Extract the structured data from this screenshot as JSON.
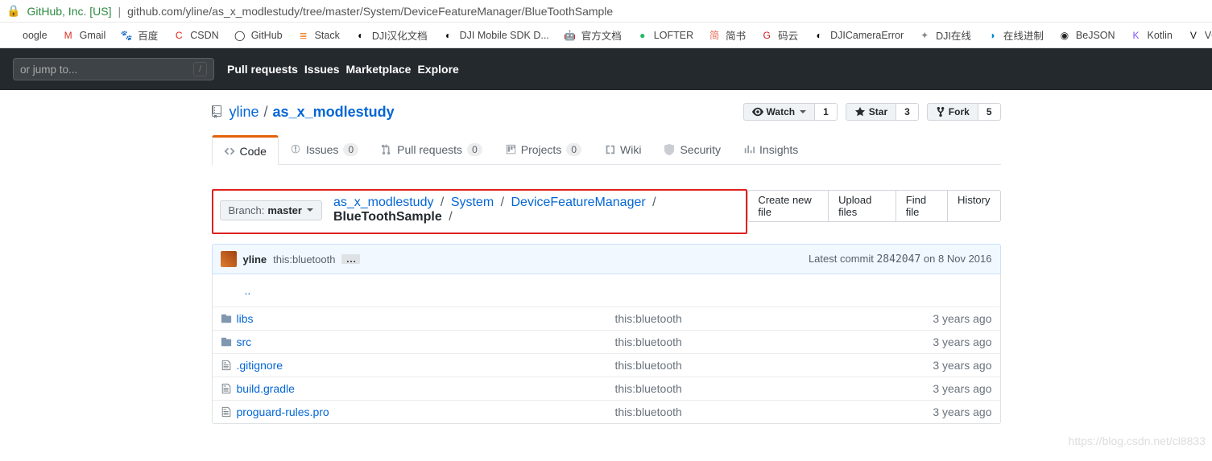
{
  "browser": {
    "host_label": "GitHub, Inc. [US]",
    "url_path": "github.com/yline/as_x_modlestudy/tree/master/System/DeviceFeatureManager/BlueToothSample"
  },
  "bookmarks": [
    {
      "label": "oogle",
      "icon": "",
      "color": ""
    },
    {
      "label": "Gmail",
      "icon": "M",
      "color": "#d93025"
    },
    {
      "label": "百度",
      "icon": "🐾",
      "color": "#2a70e8"
    },
    {
      "label": "CSDN",
      "icon": "C",
      "color": "#e1251b"
    },
    {
      "label": "GitHub",
      "icon": "◯",
      "color": "#111"
    },
    {
      "label": "Stack",
      "icon": "≣",
      "color": "#f48024"
    },
    {
      "label": "DJI汉化文档",
      "icon": "◐",
      "color": "#000"
    },
    {
      "label": "DJI Mobile SDK D...",
      "icon": "◐",
      "color": "#000"
    },
    {
      "label": "官方文档",
      "icon": "🤖",
      "color": "#3ddc84"
    },
    {
      "label": "LOFTER",
      "icon": "●",
      "color": "#2b6"
    },
    {
      "label": "简书",
      "icon": "简",
      "color": "#ea6f5a"
    },
    {
      "label": "码云",
      "icon": "G",
      "color": "#c71d23"
    },
    {
      "label": "DJICameraError",
      "icon": "◐",
      "color": "#000"
    },
    {
      "label": "DJI在线",
      "icon": "✦",
      "color": "#888"
    },
    {
      "label": "在线进制",
      "icon": "◑",
      "color": "#08c"
    },
    {
      "label": "BeJSON",
      "icon": "◉",
      "color": "#222"
    },
    {
      "label": "Kotlin",
      "icon": "K",
      "color": "#7f52ff"
    },
    {
      "label": "VOGUE",
      "icon": "V",
      "color": "#111"
    }
  ],
  "top_nav": {
    "search_placeholder": "or jump to...",
    "links": [
      "Pull requests",
      "Issues",
      "Marketplace",
      "Explore"
    ]
  },
  "repo": {
    "owner": "yline",
    "name": "as_x_modlestudy",
    "watch": {
      "label": "Watch",
      "count": "1"
    },
    "star": {
      "label": "Star",
      "count": "3"
    },
    "fork": {
      "label": "Fork",
      "count": "5"
    }
  },
  "tabs": [
    {
      "icon": "code",
      "label": "Code",
      "count": null,
      "active": true
    },
    {
      "icon": "issue",
      "label": "Issues",
      "count": "0"
    },
    {
      "icon": "pr",
      "label": "Pull requests",
      "count": "0"
    },
    {
      "icon": "project",
      "label": "Projects",
      "count": "0"
    },
    {
      "icon": "wiki",
      "label": "Wiki",
      "count": null
    },
    {
      "icon": "shield",
      "label": "Security",
      "count": null
    },
    {
      "icon": "graph",
      "label": "Insights",
      "count": null
    }
  ],
  "branch": {
    "prefix": "Branch:",
    "name": "master"
  },
  "crumbs": [
    {
      "text": "as_x_modlestudy",
      "link": true
    },
    {
      "text": "System",
      "link": true
    },
    {
      "text": "DeviceFeatureManager",
      "link": true
    },
    {
      "text": "BlueToothSample",
      "link": false
    }
  ],
  "file_actions": [
    "Create new file",
    "Upload files",
    "Find file",
    "History"
  ],
  "commit": {
    "author": "yline",
    "message": "this:bluetooth",
    "latest_label": "Latest commit",
    "sha": "2842047",
    "date_prefix": "on",
    "date": "8 Nov 2016"
  },
  "files": {
    "up": "..",
    "rows": [
      {
        "type": "dir",
        "name": "libs",
        "msg": "this:bluetooth",
        "age": "3 years ago"
      },
      {
        "type": "dir",
        "name": "src",
        "msg": "this:bluetooth",
        "age": "3 years ago"
      },
      {
        "type": "file",
        "name": ".gitignore",
        "msg": "this:bluetooth",
        "age": "3 years ago"
      },
      {
        "type": "file",
        "name": "build.gradle",
        "msg": "this:bluetooth",
        "age": "3 years ago"
      },
      {
        "type": "file",
        "name": "proguard-rules.pro",
        "msg": "this:bluetooth",
        "age": "3 years ago"
      }
    ]
  },
  "watermark": "https://blog.csdn.net/cl8833"
}
